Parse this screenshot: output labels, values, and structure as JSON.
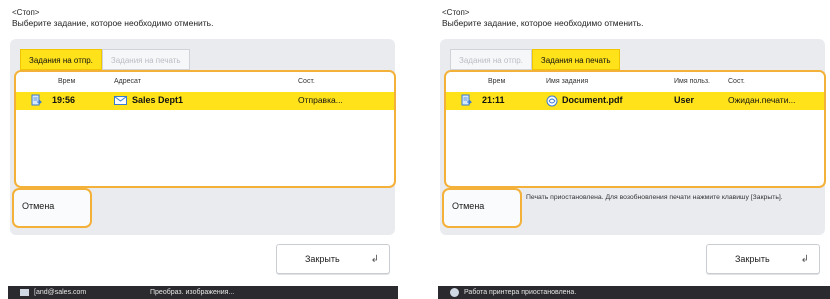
{
  "left": {
    "header_title": "<Стоп>",
    "header_prompt": "Выберите задание, которое необходимо отменить.",
    "tabs": [
      "Задания на отпр.",
      "Задания на печать"
    ],
    "columns": {
      "time": "Врем",
      "address": "Адресат",
      "status": "Сост."
    },
    "row": {
      "time": "19:56",
      "address": "Sales Dept1",
      "status": "Отправка..."
    },
    "cancel_label": "Отмена",
    "close_label": "Закрыть",
    "status_user": "[аnd@sales.com",
    "status_text": "Преобраз. изображения..."
  },
  "right": {
    "header_title": "<Стоп>",
    "header_prompt": "Выберите задание, которое необходимо отменить.",
    "tabs": [
      "Задания на отпр.",
      "Задания на печать"
    ],
    "columns": {
      "time": "Врем",
      "job": "Имя задания",
      "user": "Имя польз.",
      "status": "Сост."
    },
    "row": {
      "time": "21:11",
      "job": "Document.pdf",
      "user": "User",
      "status": "Ожидан.печати..."
    },
    "cancel_label": "Отмена",
    "message": "Печать приостановлена. Для возобновления печати нажмите клавишу [Закрыть].",
    "close_label": "Закрыть",
    "status_text": "Работа принтера приостановлена."
  },
  "colors": {
    "accent_yellow": "#ffe21a",
    "highlight_orange": "#f4b13a",
    "statusbar": "#2b2b2f"
  }
}
